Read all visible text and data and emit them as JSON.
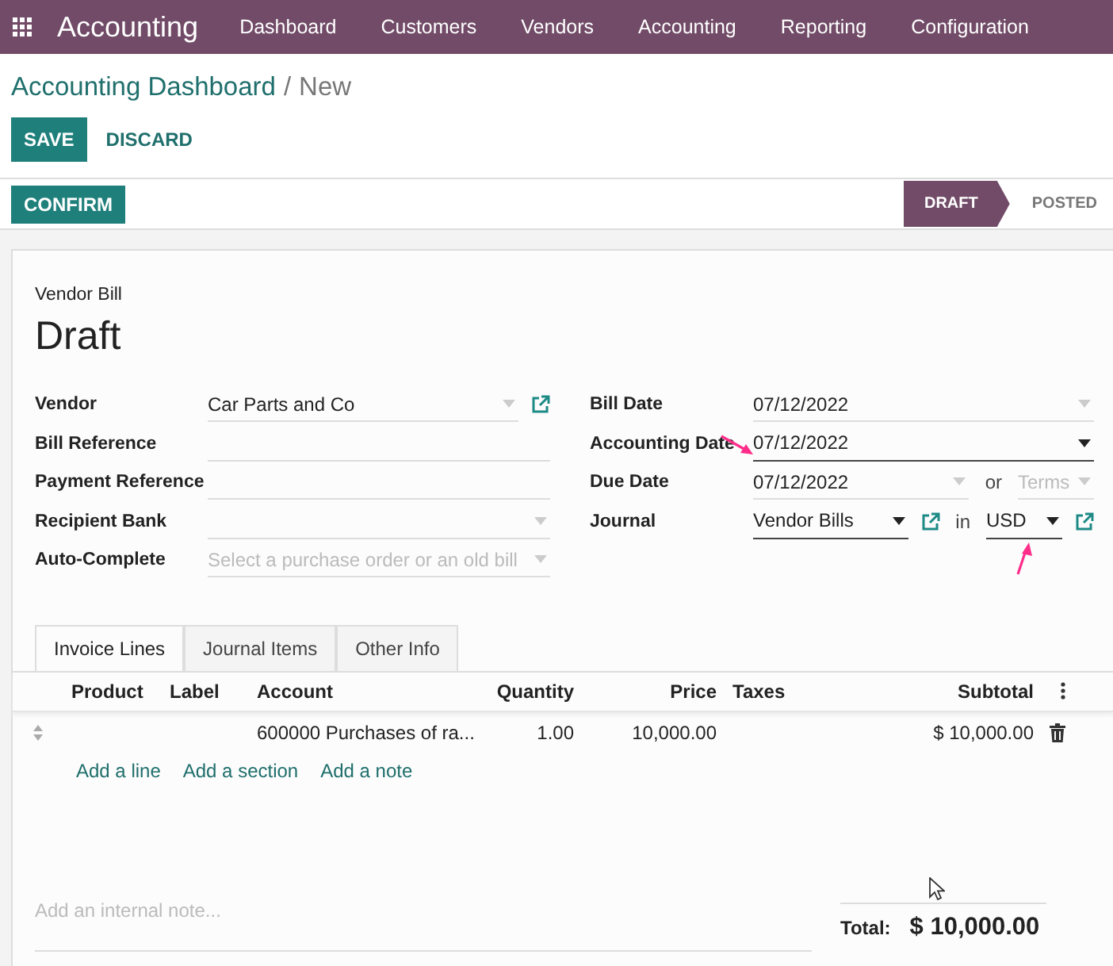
{
  "app": {
    "title": "Accounting"
  },
  "menu": [
    "Dashboard",
    "Customers",
    "Vendors",
    "Accounting",
    "Reporting",
    "Configuration"
  ],
  "breadcrumb": {
    "parent": "Accounting Dashboard",
    "separator": "/",
    "current": "New"
  },
  "buttons": [
    "SAVE",
    "DISCARD"
  ],
  "confirm": "CONFIRM",
  "stages": [
    {
      "label": "DRAFT",
      "selected": true
    },
    {
      "label": "POSTED",
      "selected": false
    }
  ],
  "document": {
    "type": "Vendor Bill",
    "status": "Draft"
  },
  "left_fields": [
    {
      "label": "Vendor",
      "parts": [
        {
          "kind": "input",
          "value": "Car Parts and Co",
          "dropdown": true,
          "active": false,
          "link": true
        }
      ]
    },
    {
      "label": "Bill Reference",
      "parts": [
        {
          "kind": "input",
          "dropdown": false,
          "active": false,
          "link": false
        }
      ]
    },
    {
      "label": "Payment Reference",
      "parts": [
        {
          "kind": "input",
          "dropdown": false,
          "active": false,
          "link": false
        }
      ]
    },
    {
      "label": "Recipient Bank",
      "parts": [
        {
          "kind": "input",
          "dropdown": true,
          "active": false,
          "link": false
        }
      ]
    },
    {
      "label": "Auto-Complete",
      "parts": [
        {
          "kind": "input",
          "placeholder": "Select a purchase order or an old bill",
          "dropdown": true,
          "active": false,
          "link": false
        }
      ]
    }
  ],
  "right_fields": [
    {
      "label": "Bill Date",
      "parts": [
        {
          "kind": "input",
          "value": "07/12/2022",
          "dropdown": true,
          "active": false,
          "link": false
        }
      ]
    },
    {
      "label": "Accounting Date",
      "parts": [
        {
          "kind": "input",
          "value": "07/12/2022",
          "dropdown": true,
          "active": true,
          "link": false
        }
      ]
    },
    {
      "label": "Due Date",
      "parts": [
        {
          "kind": "input",
          "value": "07/12/2022",
          "dropdown": true,
          "active": false,
          "link": false
        },
        {
          "kind": "word",
          "text": "or"
        },
        {
          "kind": "input",
          "placeholder": "Terms",
          "dropdown": true,
          "active": false,
          "link": false
        }
      ]
    },
    {
      "label": "Journal",
      "parts": [
        {
          "kind": "input",
          "value": "Vendor Bills",
          "dropdown": true,
          "active": true,
          "link": true
        },
        {
          "kind": "word",
          "text": "in"
        },
        {
          "kind": "input",
          "value": "USD",
          "dropdown": true,
          "active": true,
          "link": true
        }
      ]
    }
  ],
  "tabs": [
    {
      "label": "Invoice Lines",
      "selected": true
    },
    {
      "label": "Journal Items",
      "selected": false
    },
    {
      "label": "Other Info",
      "selected": false
    }
  ],
  "table": {
    "columns": [
      "Product",
      "Label",
      "Account",
      "Quantity",
      "Price",
      "Taxes",
      "Subtotal"
    ],
    "rows": [
      {
        "cells": [
          "",
          "",
          "600000 Purchases of ra...",
          "1.00",
          "10,000.00",
          "",
          "$ 10,000.00"
        ]
      }
    ]
  },
  "add_links": [
    "Add a line",
    "Add a section",
    "Add a note"
  ],
  "note": {
    "placeholder": "Add an internal note..."
  },
  "total": {
    "label": "Total:",
    "value": "$ 10,000.00"
  }
}
